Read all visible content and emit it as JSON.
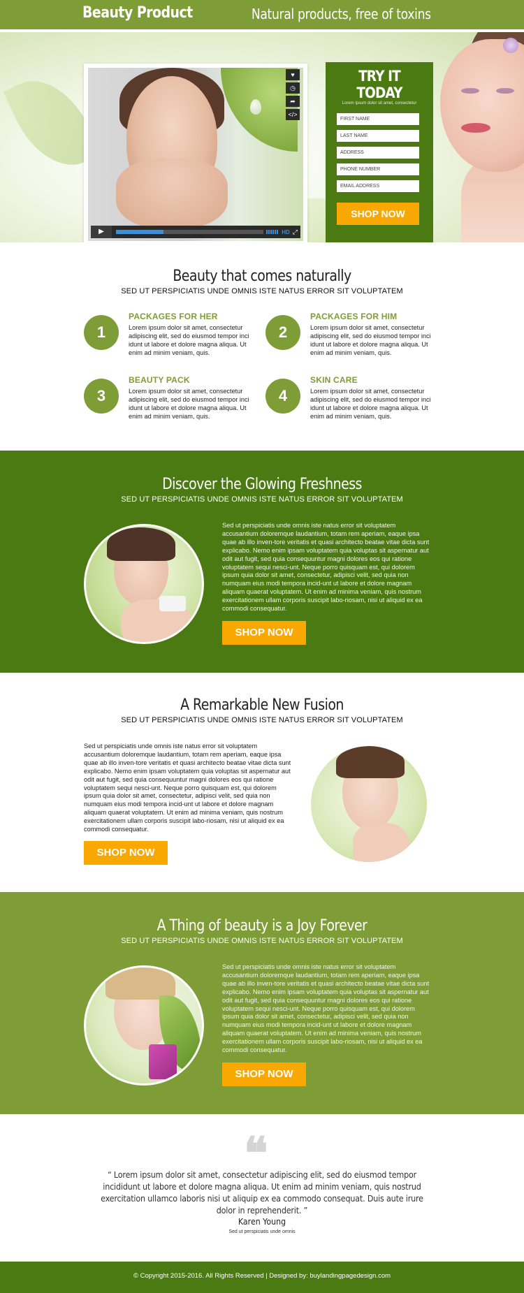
{
  "header": {
    "brand": "Beauty Product",
    "tagline": "Natural products, free of toxins"
  },
  "hero": {
    "video": {
      "side_buttons": [
        "LIKE",
        "LATER",
        "SHARE",
        "EMBED"
      ],
      "hd_label": "HD",
      "progress": 0.32
    },
    "form": {
      "title": "TRY IT TODAY",
      "subtitle": "Lorem ipsum dolor sit amet, consectetur",
      "fields": [
        {
          "placeholder": "FIRST NAME"
        },
        {
          "placeholder": "LAST NAME"
        },
        {
          "placeholder": "ADDRESS"
        },
        {
          "placeholder": "PHONE NUMBER"
        },
        {
          "placeholder": "EMAIL ADDRESS"
        }
      ],
      "cta": "SHOP NOW"
    }
  },
  "features": {
    "title": "Beauty that comes naturally",
    "subtitle": "SED UT PERSPICIATIS UNDE OMNIS ISTE NATUS ERROR SIT VOLUPTATEM",
    "items": [
      {
        "num": "1",
        "title": "PACKAGES FOR HER",
        "text": "Lorem ipsum dolor sit amet, consectetur adipiscing elit, sed do eiusmod tempor inci idunt ut labore et dolore magna aliqua. Ut enim ad minim veniam, quis."
      },
      {
        "num": "2",
        "title": "PACKAGES FOR HIM",
        "text": "Lorem ipsum dolor sit amet, consectetur adipiscing elit, sed do eiusmod tempor inci idunt ut labore et dolore magna aliqua. Ut enim ad minim veniam, quis."
      },
      {
        "num": "3",
        "title": "BEAUTY PACK",
        "text": "Lorem ipsum dolor sit amet, consectetur adipiscing elit, sed do eiusmod tempor inci idunt ut labore et dolore magna aliqua. Ut enim ad minim veniam, quis."
      },
      {
        "num": "4",
        "title": "SKIN CARE",
        "text": "Lorem ipsum dolor sit amet, consectetur adipiscing elit, sed do eiusmod tempor inci idunt ut labore et dolore magna aliqua. Ut enim ad minim veniam, quis."
      }
    ]
  },
  "section_freshness": {
    "title": "Discover the Glowing Freshness",
    "subtitle": "SED UT PERSPICIATIS UNDE OMNIS ISTE NATUS ERROR SIT VOLUPTATEM",
    "text": "Sed ut perspiciatis unde omnis iste natus error sit voluptatem accusantium doloremque laudantium, totam rem aperiam, eaque ipsa quae ab illo inven-tore veritatis et quasi architecto beatae vitae dicta sunt explicabo. Nemo enim ipsam voluptatem quia voluptas sit aspernatur aut odit aut fugit, sed quia consequuntur magni dolores eos qui ratione voluptatem sequi nesci-unt. Neque porro quisquam est, qui dolorem ipsum quia dolor sit amet, consectetur, adipisci velit, sed quia non numquam eius modi tempora incid-unt ut labore et dolore magnam aliquam quaerat voluptatem. Ut enim ad minima veniam, quis nostrum exercitationem ullam corporis suscipit labo-riosam, nisi ut aliquid ex ea commodi consequatur.",
    "cta": "SHOP NOW"
  },
  "section_fusion": {
    "title": "A Remarkable New Fusion",
    "subtitle": "SED UT PERSPICIATIS UNDE OMNIS ISTE NATUS ERROR SIT VOLUPTATEM",
    "text": "Sed ut perspiciatis unde omnis iste natus error sit voluptatem accusantium doloremque laudantium, totam rem aperiam, eaque ipsa quae ab illo inven-tore veritatis et quasi architecto beatae vitae dicta sunt explicabo. Nemo enim ipsam voluptatem quia voluptas sit aspernatur aut odit aut fugit, sed quia consequuntur magni dolores eos qui ratione voluptatem sequi nesci-unt. Neque porro quisquam est, qui dolorem ipsum quia dolor sit amet, consectetur, adipisci velit, sed quia non numquam eius modi tempora incid-unt ut labore et dolore magnam aliquam quaerat voluptatem. Ut enim ad minima veniam, quis nostrum exercitationem ullam corporis suscipit labo-riosam, nisi ut aliquid ex ea commodi consequatur.",
    "cta": "SHOP NOW"
  },
  "section_joy": {
    "title": "A Thing of beauty is a Joy Forever",
    "subtitle": "SED UT PERSPICIATIS UNDE OMNIS ISTE NATUS ERROR SIT VOLUPTATEM",
    "text": "Sed ut perspiciatis unde omnis iste natus error sit voluptatem accusantium doloremque laudantium, totam rem aperiam, eaque ipsa quae ab illo inven-tore veritatis et quasi architecto beatae vitae dicta sunt explicabo. Nemo enim ipsam voluptatem quia voluptas sit aspernatur aut odit aut fugit, sed quia consequuntur magni dolores eos qui ratione voluptatem sequi nesci-unt. Neque porro quisquam est, qui dolorem ipsum quia dolor sit amet, consectetur, adipisci velit, sed quia non numquam eius modi tempora incid-unt ut labore et dolore magnam aliquam quaerat voluptatem. Ut enim ad minima veniam, quis nostrum exercitationem ullam corporis suscipit labo-riosam, nisi ut aliquid ex ea commodi consequatur.",
    "cta": "SHOP NOW"
  },
  "testimonial": {
    "quote": "“ Lorem ipsum dolor sit amet, consectetur adipiscing elit, sed do eiusmod tempor incididunt ut labore et dolore magna aliqua. Ut enim ad minim veniam, quis nostrud exercitation ullamco laboris nisi ut aliquip ex ea commodo consequat. Duis aute irure dolor in reprehenderit. ”",
    "author": "Karen Young",
    "author_sub": "Sed ut perspiciatis unde omnis"
  },
  "footer": {
    "text": "© Copyright 2015-2016. All Rights Reserved  |  Designed by: buylandingpagedesign.com"
  },
  "colors": {
    "brand_green": "#7f9d36",
    "dark_green": "#4b7a12",
    "cta_orange": "#f8a800"
  }
}
